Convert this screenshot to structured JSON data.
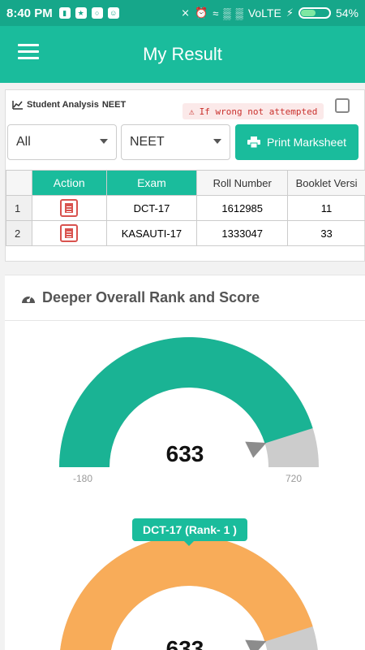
{
  "status": {
    "time": "8:40 PM",
    "network": "VoLTE",
    "battery": "54%",
    "battery_level": 0.54
  },
  "appbar": {
    "title": "My Result"
  },
  "analysis": {
    "label": "Student Analysis",
    "exam": "NEET",
    "warning": "If wrong not attempted"
  },
  "filters": {
    "filter1": "All",
    "filter2": "NEET",
    "print_label": "Print Marksheet"
  },
  "table": {
    "headers": [
      "Action",
      "Exam",
      "Roll Number",
      "Booklet Versi"
    ],
    "rows": [
      {
        "idx": "1",
        "exam": "DCT-17",
        "roll": "1612985",
        "booklet": "11"
      },
      {
        "idx": "2",
        "exam": "KASAUTI-17",
        "roll": "1333047",
        "booklet": "33"
      }
    ]
  },
  "rank": {
    "title": "Deeper Overall Rank and Score",
    "gauge1": {
      "value": "633",
      "min": "-180",
      "max": "720",
      "fill_fraction": 0.903,
      "color": "#1ab394"
    },
    "badge": "DCT-17 (Rank- 1 )",
    "gauge2": {
      "value": "633",
      "fill_fraction": 0.903,
      "color": "#f8ac59"
    }
  },
  "colors": {
    "brand": "#1abc9c",
    "statusbar": "#16a78a",
    "danger": "#d9534f",
    "track": "#cccccc"
  }
}
